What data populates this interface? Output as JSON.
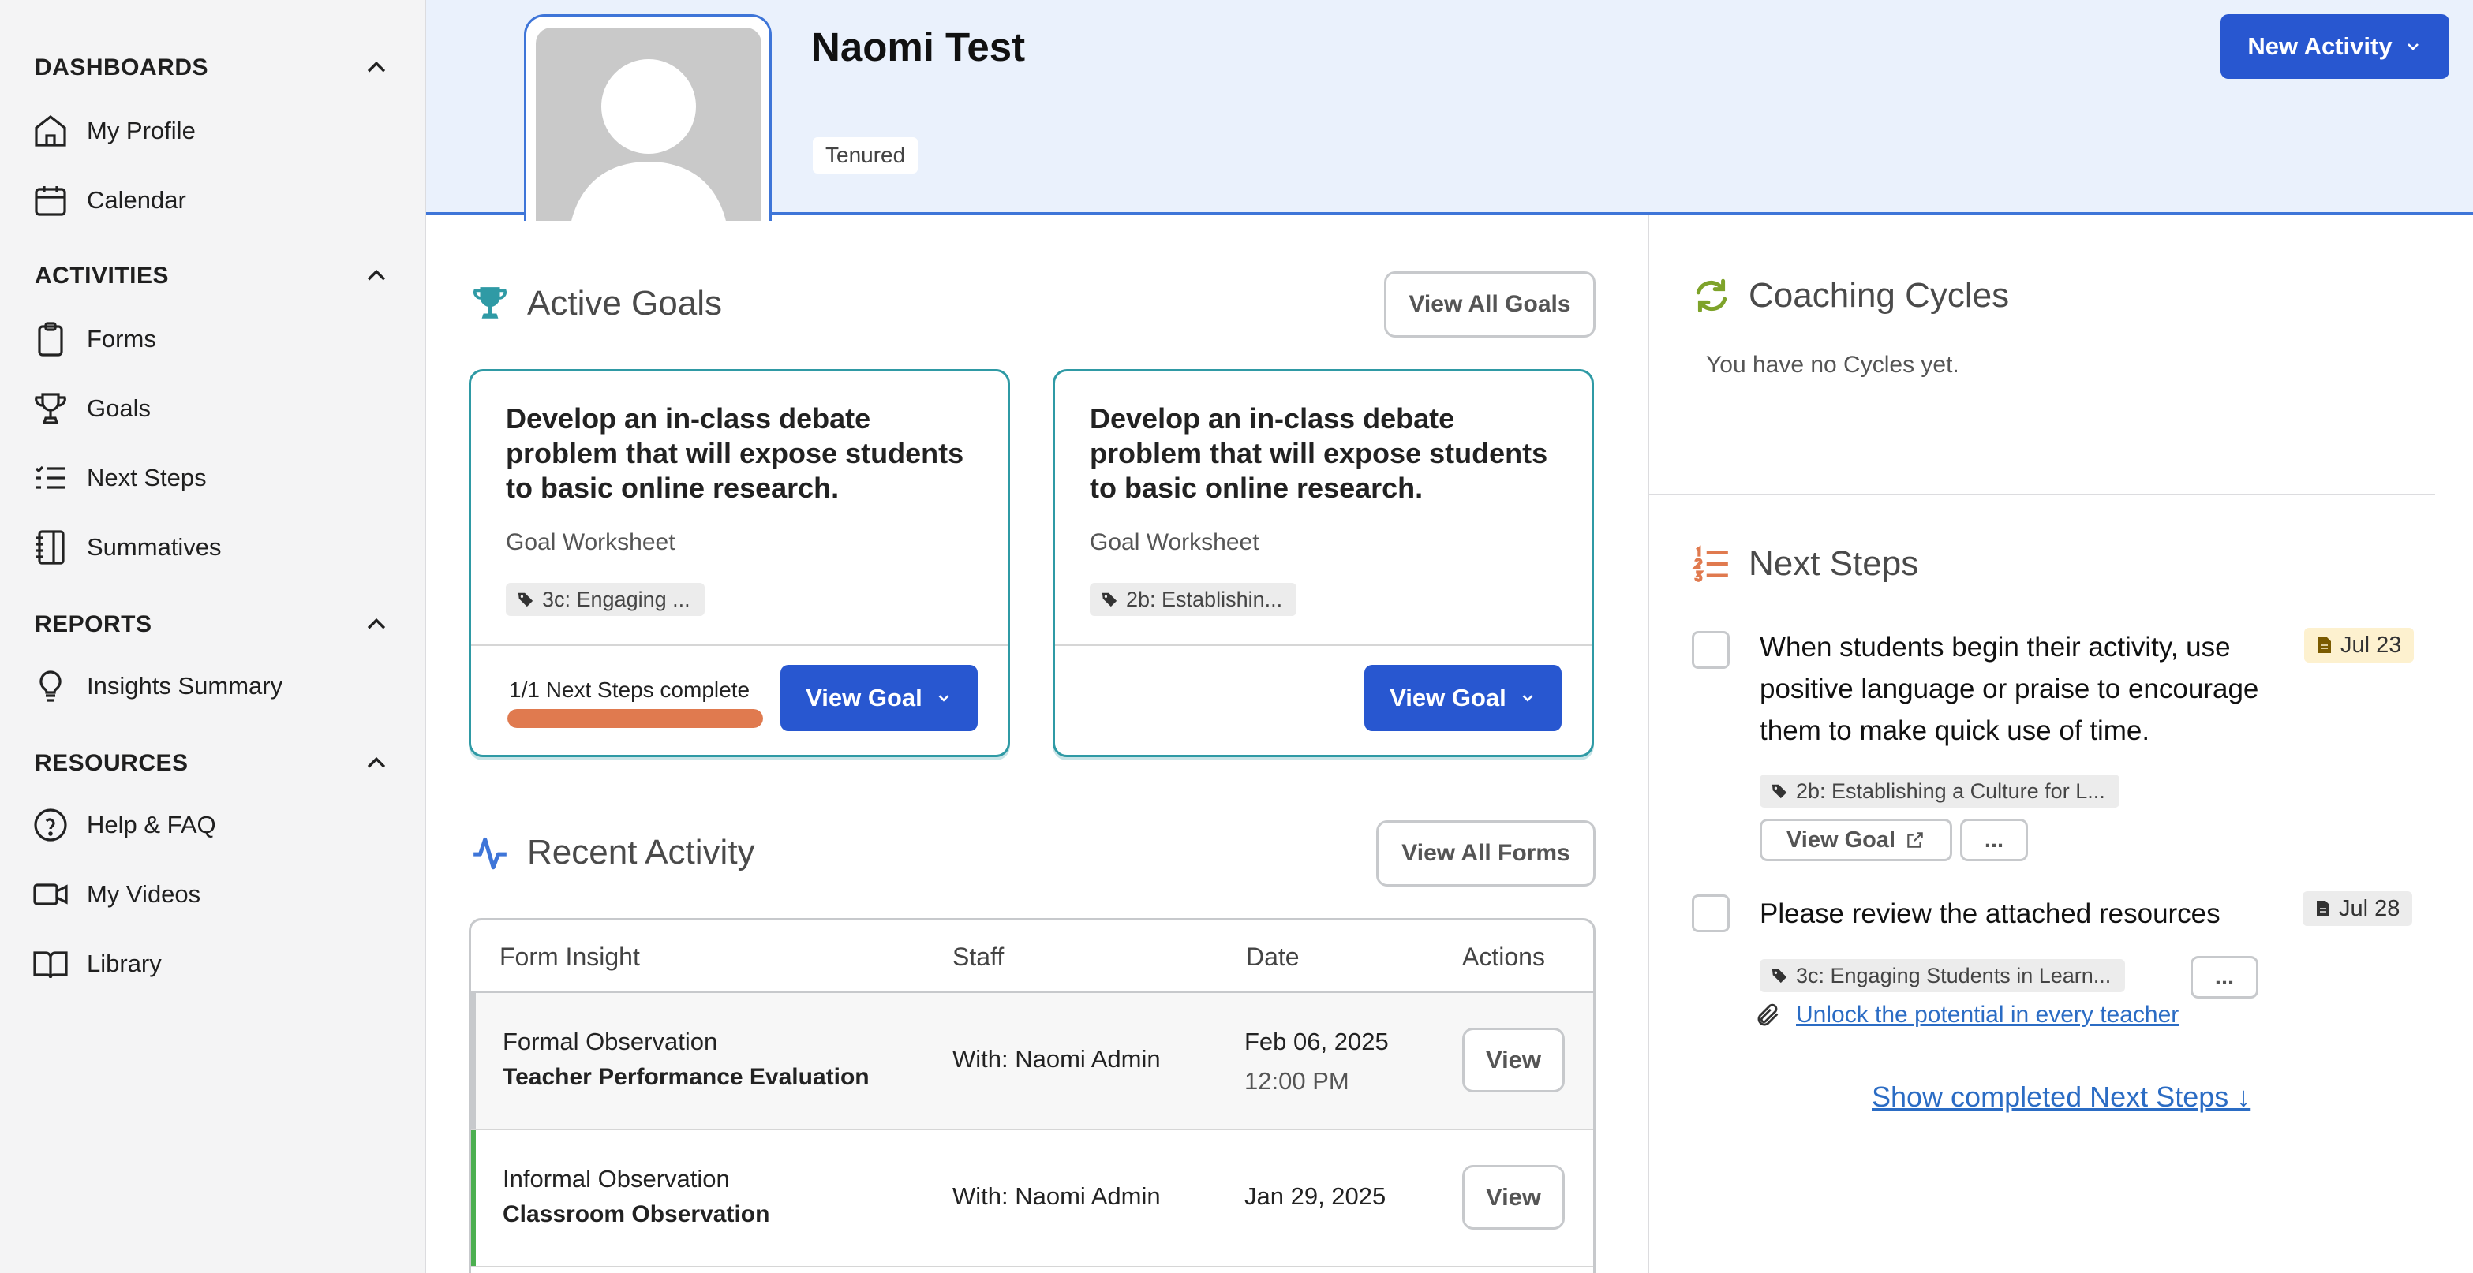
{
  "sidebar": {
    "sections": [
      {
        "title": "DASHBOARDS",
        "items": [
          {
            "label": "My Profile",
            "icon": "home-icon"
          },
          {
            "label": "Calendar",
            "icon": "calendar-icon"
          }
        ]
      },
      {
        "title": "ACTIVITIES",
        "items": [
          {
            "label": "Forms",
            "icon": "clipboard-icon"
          },
          {
            "label": "Goals",
            "icon": "trophy-icon"
          },
          {
            "label": "Next Steps",
            "icon": "list-icon"
          },
          {
            "label": "Summatives",
            "icon": "notebook-icon"
          }
        ]
      },
      {
        "title": "REPORTS",
        "items": [
          {
            "label": "Insights Summary",
            "icon": "lightbulb-icon"
          }
        ]
      },
      {
        "title": "RESOURCES",
        "items": [
          {
            "label": "Help & FAQ",
            "icon": "help-icon"
          },
          {
            "label": "My Videos",
            "icon": "video-icon"
          },
          {
            "label": "Library",
            "icon": "book-icon"
          }
        ]
      }
    ]
  },
  "profile": {
    "name": "Naomi Test",
    "status": "Tenured",
    "new_activity_label": "New Activity"
  },
  "active_goals": {
    "title": "Active Goals",
    "view_all_label": "View All Goals",
    "cards": [
      {
        "title": "Develop an in-class debate problem that will expose students to basic online research.",
        "type": "Goal Worksheet",
        "tag": "3c: Engaging ...",
        "progress_label": "1/1 Next Steps complete",
        "progress": 1.0,
        "button": "View Goal"
      },
      {
        "title": "Develop an in-class debate problem that will expose students to basic online research.",
        "type": "Goal Worksheet",
        "tag": "2b: Establishin...",
        "button": "View Goal"
      }
    ]
  },
  "recent_activity": {
    "title": "Recent Activity",
    "view_all_label": "View All Forms",
    "columns": [
      "Form Insight",
      "Staff",
      "Date",
      "Actions"
    ],
    "rows": [
      {
        "type": "Formal Observation",
        "form": "Teacher Performance Evaluation",
        "staff": "With: Naomi Admin",
        "date": "Feb 06, 2025",
        "time": "12:00 PM",
        "action": "View",
        "accent": "#c7c9cc"
      },
      {
        "type": "Informal Observation",
        "form": "Classroom Observation",
        "staff": "With: Naomi Admin",
        "date": "Jan 29, 2025",
        "time": "",
        "action": "View",
        "accent": "#4caf50"
      }
    ]
  },
  "coaching_cycles": {
    "title": "Coaching Cycles",
    "empty_text": "You have no Cycles yet."
  },
  "next_steps": {
    "title": "Next Steps",
    "items": [
      {
        "text": "When students begin their activity, use positive language or praise to encourage them to make quick use of time.",
        "date": "Jul 23",
        "tag": "2b: Establishing a Culture for L...",
        "view_goal_label": "View Goal",
        "more_label": "..."
      },
      {
        "text": "Please review the attached resources",
        "date": "Jul 28",
        "tag": "3c: Engaging Students in Learn...",
        "more_label": "...",
        "attachment": "Unlock the potential in every teacher"
      }
    ],
    "show_completed_label": "Show completed Next Steps ↓"
  },
  "colors": {
    "primary": "#2857d0",
    "teal": "#2f9aa5",
    "progress": "#e07a4f",
    "header_bg": "#eaf1fc",
    "date_badge_warn": "#fdf1cf"
  }
}
